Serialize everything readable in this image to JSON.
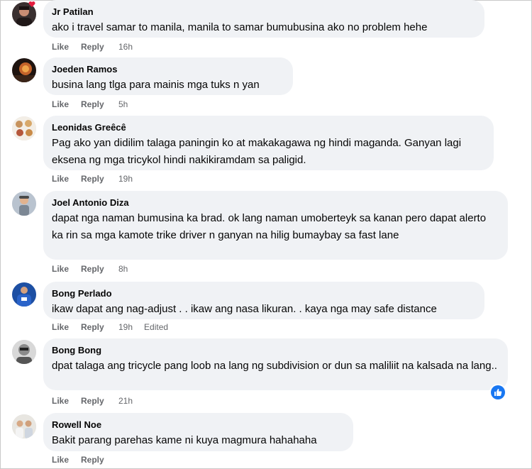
{
  "comments": [
    {
      "author": "Jr Patilan",
      "text": "ako i travel samar to manila, manila to samar bumubusina ako no problem hehe",
      "like": "Like",
      "reply": "Reply",
      "time": "16h",
      "edited": ""
    },
    {
      "author": "Joeden Ramos",
      "text": "busina lang tlga para mainis mga tuks n yan",
      "like": "Like",
      "reply": "Reply",
      "time": "5h",
      "edited": ""
    },
    {
      "author": "Leonidas Greêcê",
      "text": "Pag ako yan didilim talaga paningin ko at makakagawa ng hindi maganda. Ganyan lagi eksena ng mga tricykol hindi nakikiramdam sa paligid.",
      "like": "Like",
      "reply": "Reply",
      "time": "19h",
      "edited": ""
    },
    {
      "author": "Joel Antonio Diza",
      "text": "dapat nga naman bumusina ka brad. ok lang naman umoberteyk sa kanan pero dapat alerto ka rin sa mga kamote trike driver n ganyan na hilig bumaybay sa fast lane",
      "like": "Like",
      "reply": "Reply",
      "time": "8h",
      "edited": ""
    },
    {
      "author": "Bong Perlado",
      "text": "ikaw dapat ang nag-adjust . . ikaw ang nasa likuran. . kaya nga may safe distance",
      "like": "Like",
      "reply": "Reply",
      "time": "19h",
      "edited": "Edited"
    },
    {
      "author": "Bong Bong",
      "text": "dpat talaga ang tricycle pang loob na lang ng subdivision or dun sa maliliit na kalsada na lang..",
      "like": "Like",
      "reply": "Reply",
      "time": "21h",
      "edited": ""
    },
    {
      "author": "Rowell Noe",
      "text": "Bakit parang parehas kame ni kuya magmura hahahaha",
      "like": "Like",
      "reply": "Reply",
      "time": "",
      "edited": ""
    }
  ],
  "icons": {
    "reaction": "like-thumb-icon",
    "heart": "heart-icon"
  },
  "colors": {
    "bubble": "#f0f2f5",
    "meta": "#65676b",
    "like_badge": "#1877f2"
  }
}
